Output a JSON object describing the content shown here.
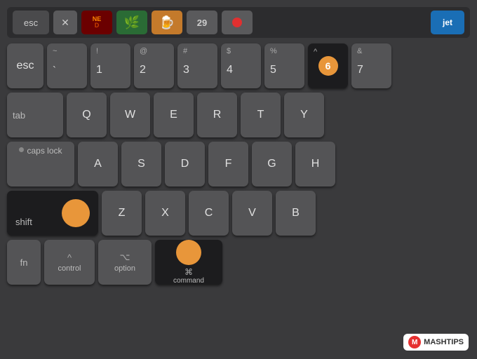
{
  "touchbar": {
    "esc": "esc",
    "jet": "jet",
    "apps": [
      {
        "name": "close-btn",
        "symbol": "✕"
      },
      {
        "name": "ned-app",
        "text": "NED"
      },
      {
        "name": "leaf-app",
        "text": "🌿"
      },
      {
        "name": "cup-app",
        "text": "🍺"
      },
      {
        "name": "29-app",
        "text": "29"
      },
      {
        "name": "rec-app",
        "text": "⏺"
      }
    ]
  },
  "rows": {
    "row1": {
      "keys": [
        "~\n`",
        "!\n1",
        "@\n2",
        "#\n3",
        "$\n4",
        "%\n5",
        "^\n6",
        "&\n7"
      ]
    },
    "row2": {
      "tab": "tab",
      "keys": [
        "Q",
        "W",
        "E",
        "R",
        "T",
        "Y"
      ]
    },
    "row3": {
      "caps": "caps lock",
      "keys": [
        "A",
        "S",
        "D",
        "F",
        "G",
        "H"
      ]
    },
    "row4": {
      "shift": "shift",
      "keys": [
        "Z",
        "X",
        "C",
        "V",
        "B"
      ]
    },
    "row5": {
      "fn": "fn",
      "control": "control",
      "option": "option",
      "command": "command",
      "cmd_symbol": "⌘",
      "ctrl_symbol": "^",
      "opt_symbol": "⌥"
    }
  },
  "watermark": {
    "m": "M",
    "text": "MASHTIPS"
  },
  "colors": {
    "orange": "#e8963a",
    "dark_key": "#1c1c1e",
    "normal_key": "#545456",
    "bg": "#3a3a3c"
  }
}
